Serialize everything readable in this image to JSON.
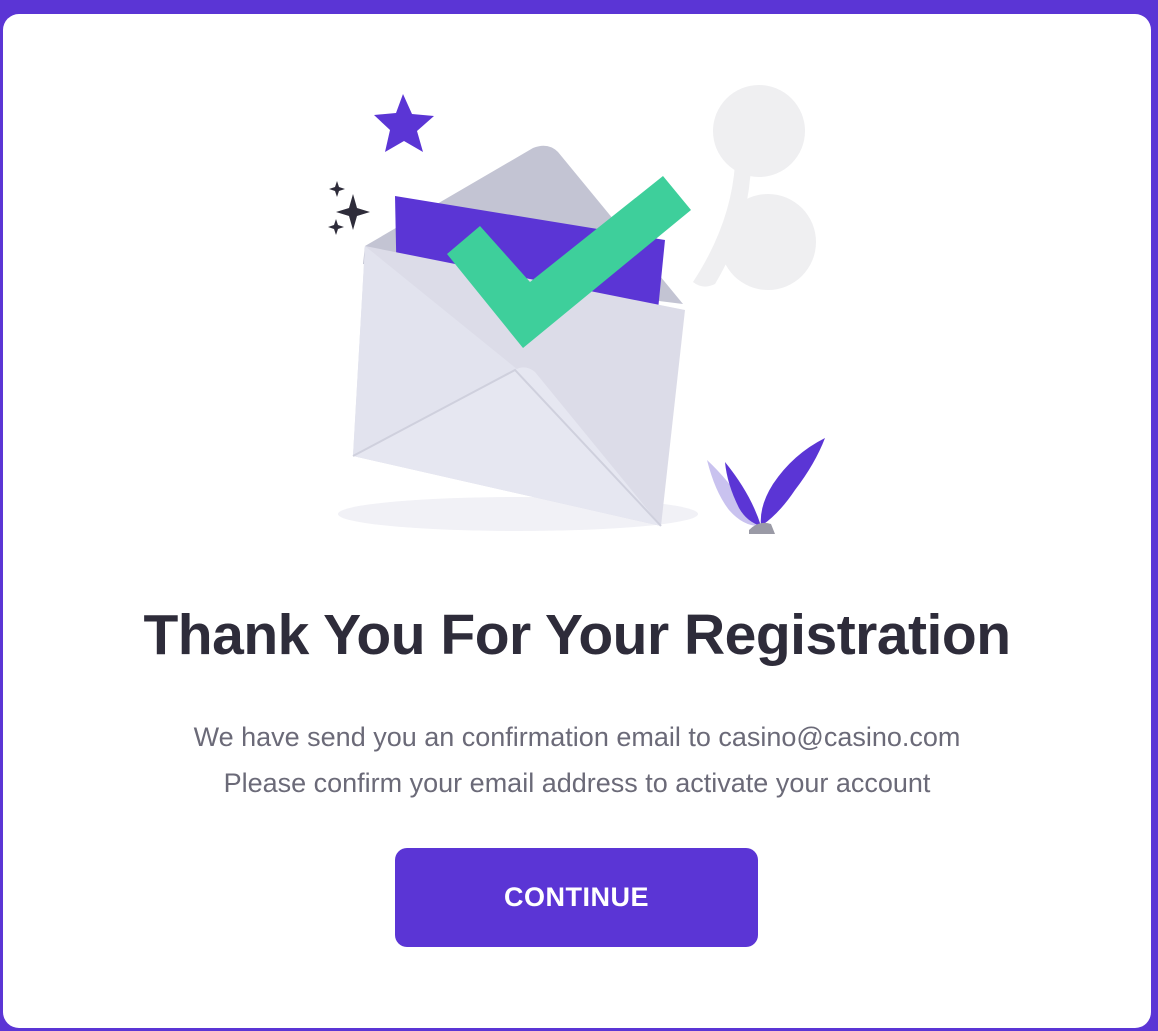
{
  "dialog": {
    "title": "Thank You For Your Registration",
    "message_line1": "We have send you an confirmation email to casino@casino.com",
    "message_line2": "Please confirm your email address to activate your account",
    "continue_label": "CONTINUE"
  },
  "illustration": {
    "icons": [
      "star-icon",
      "sparkle-icon",
      "envelope-icon",
      "checkmark-icon",
      "leaf-icon",
      "cloud-decoration"
    ]
  },
  "colors": {
    "brand": "#5b35d5",
    "check": "#3ecf9b",
    "title": "#2e2c3a",
    "text": "#6b6a78",
    "envelope": "#e4e5f0"
  }
}
